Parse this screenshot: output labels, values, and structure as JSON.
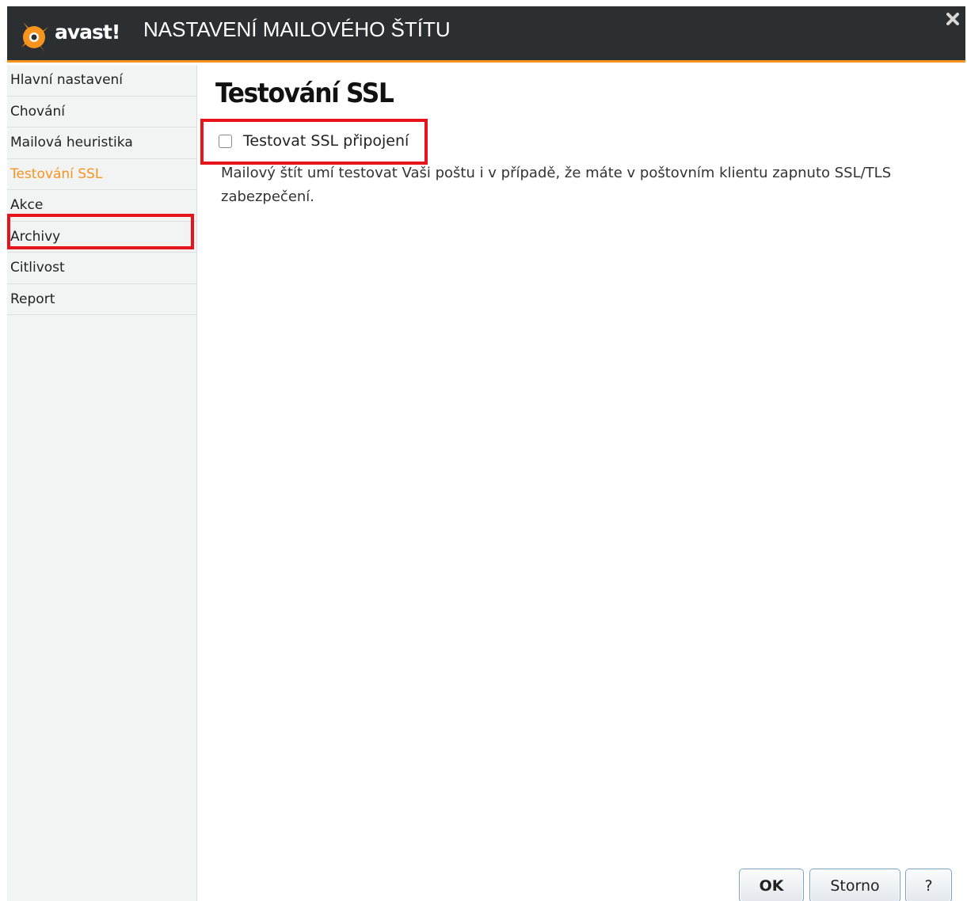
{
  "window": {
    "brand": "avast!",
    "title": "NASTAVENÍ MAILOVÉHO ŠTÍTU"
  },
  "sidebar": {
    "items": [
      {
        "label": "Hlavní nastavení"
      },
      {
        "label": "Chování"
      },
      {
        "label": "Mailová heuristika"
      },
      {
        "label": "Testování SSL",
        "active": true
      },
      {
        "label": "Akce"
      },
      {
        "label": "Archivy"
      },
      {
        "label": "Citlivost"
      },
      {
        "label": "Report"
      }
    ]
  },
  "main": {
    "title": "Testování SSL",
    "checkbox_label": "Testovat SSL připojení",
    "checkbox_checked": false,
    "description": "Mailový štít umí testovat Vaši poštu i v případě, že máte v poštovním klientu zapnuto SSL/TLS zabezpečení."
  },
  "buttons": {
    "ok": "OK",
    "cancel": "Storno",
    "help": "?"
  },
  "colors": {
    "accent": "#f7941d",
    "titlebar": "#2b2f31",
    "highlight": "#e8141c"
  }
}
